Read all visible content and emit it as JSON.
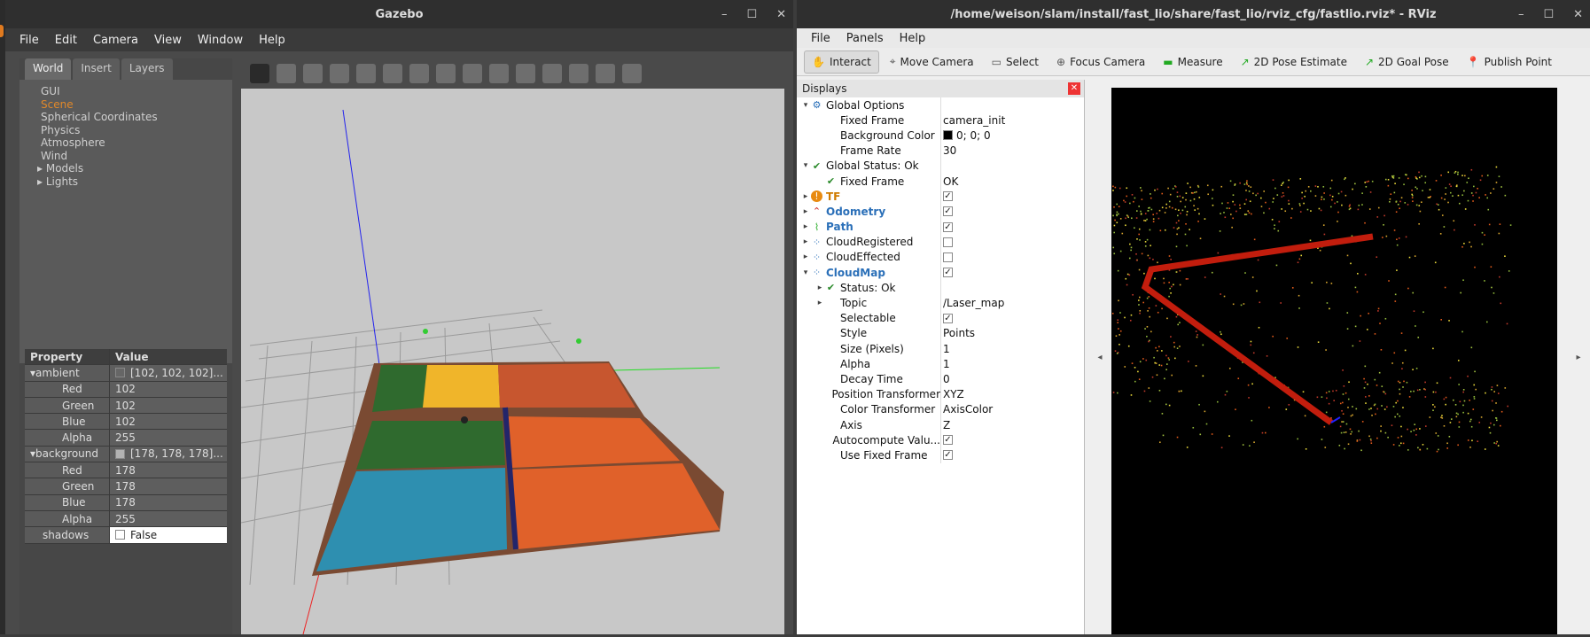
{
  "gazebo": {
    "title": "Gazebo",
    "menu": [
      "File",
      "Edit",
      "Camera",
      "View",
      "Window",
      "Help"
    ],
    "tabs": [
      "World",
      "Insert",
      "Layers"
    ],
    "tree": [
      "GUI",
      "Scene",
      "Spherical Coordinates",
      "Physics",
      "Atmosphere",
      "Wind"
    ],
    "tree_expand": [
      "Models",
      "Lights"
    ],
    "prop_header": {
      "k": "Property",
      "v": "Value"
    },
    "props": [
      {
        "k": "ambient",
        "v": "[102, 102, 102]...",
        "group": true
      },
      {
        "k": "Red",
        "v": "102"
      },
      {
        "k": "Green",
        "v": "102"
      },
      {
        "k": "Blue",
        "v": "102"
      },
      {
        "k": "Alpha",
        "v": "255"
      },
      {
        "k": "background",
        "v": "[178, 178, 178]...",
        "group": true
      },
      {
        "k": "Red",
        "v": "178"
      },
      {
        "k": "Green",
        "v": "178"
      },
      {
        "k": "Blue",
        "v": "178"
      },
      {
        "k": "Alpha",
        "v": "255"
      },
      {
        "k": "shadows",
        "v": "False",
        "white": true
      }
    ]
  },
  "rviz": {
    "title": "/home/weison/slam/install/fast_lio/share/fast_lio/rviz_cfg/fastlio.rviz* - RViz",
    "menu": [
      "File",
      "Panels",
      "Help"
    ],
    "tools": [
      "Interact",
      "Move Camera",
      "Select",
      "Focus Camera",
      "Measure",
      "2D Pose Estimate",
      "2D Goal Pose",
      "Publish Point"
    ],
    "displays_title": "Displays",
    "rows": [
      {
        "n": "Global Options",
        "v": "",
        "lvl": 0,
        "exp": "▾",
        "icon": "gear-icon"
      },
      {
        "n": "Fixed Frame",
        "v": "camera_init",
        "lvl": 1
      },
      {
        "n": "Background Color",
        "v": "0; 0; 0",
        "lvl": 1,
        "swatch": "#000000"
      },
      {
        "n": "Frame Rate",
        "v": "30",
        "lvl": 1
      },
      {
        "n": "Global Status: Ok",
        "v": "",
        "lvl": 0,
        "exp": "▾",
        "icon": "check-icon"
      },
      {
        "n": "Fixed Frame",
        "v": "OK",
        "lvl": 1,
        "icon": "check-icon"
      },
      {
        "n": "TF",
        "v": "",
        "lvl": 0,
        "exp": "▸",
        "icon": "warning-icon",
        "style": "orng",
        "cb": true
      },
      {
        "n": "Odometry",
        "v": "",
        "lvl": 0,
        "exp": "▸",
        "icon": "odometry-icon",
        "style": "blue",
        "cb": true
      },
      {
        "n": "Path",
        "v": "",
        "lvl": 0,
        "exp": "▸",
        "icon": "path-icon",
        "style": "blue",
        "cb": true
      },
      {
        "n": "CloudRegistered",
        "v": "",
        "lvl": 0,
        "exp": "▸",
        "icon": "cloud-icon",
        "cb": false
      },
      {
        "n": "CloudEffected",
        "v": "",
        "lvl": 0,
        "exp": "▸",
        "icon": "cloud-icon",
        "cb": false
      },
      {
        "n": "CloudMap",
        "v": "",
        "lvl": 0,
        "exp": "▾",
        "icon": "cloud-icon",
        "style": "blue",
        "cb": true
      },
      {
        "n": "Status: Ok",
        "v": "",
        "lvl": 1,
        "exp": "▸",
        "icon": "check-icon"
      },
      {
        "n": "Topic",
        "v": "/Laser_map",
        "lvl": 1,
        "exp": "▸"
      },
      {
        "n": "Selectable",
        "v": "",
        "lvl": 1,
        "cb": true
      },
      {
        "n": "Style",
        "v": "Points",
        "lvl": 1
      },
      {
        "n": "Size (Pixels)",
        "v": "1",
        "lvl": 1
      },
      {
        "n": "Alpha",
        "v": "1",
        "lvl": 1
      },
      {
        "n": "Decay Time",
        "v": "0",
        "lvl": 1
      },
      {
        "n": "Position Transformer",
        "v": "XYZ",
        "lvl": 1
      },
      {
        "n": "Color Transformer",
        "v": "AxisColor",
        "lvl": 1
      },
      {
        "n": "Axis",
        "v": "Z",
        "lvl": 1
      },
      {
        "n": "Autocompute Valu...",
        "v": "",
        "lvl": 1,
        "cb": true
      },
      {
        "n": "Use Fixed Frame",
        "v": "",
        "lvl": 1,
        "cb": true
      }
    ]
  }
}
